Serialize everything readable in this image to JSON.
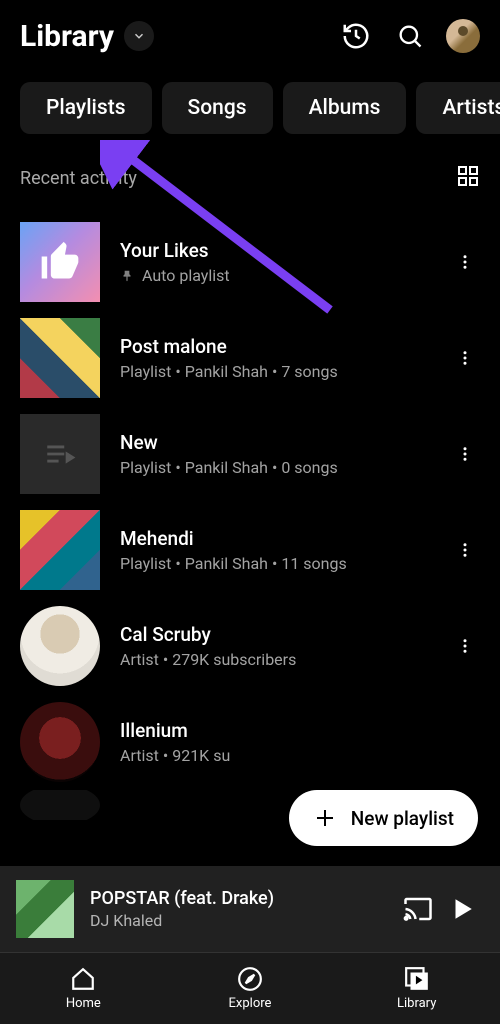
{
  "header": {
    "title": "Library"
  },
  "chips": {
    "playlists": "Playlists",
    "songs": "Songs",
    "albums": "Albums",
    "artists": "Artists"
  },
  "section": {
    "label": "Recent activity"
  },
  "items": [
    {
      "title": "Your Likes",
      "sub": "Auto playlist",
      "pinned": true,
      "artClass": "likes"
    },
    {
      "title": "Post malone",
      "sub": "Playlist • Pankil Shah • 7 songs",
      "artClass": "collage1"
    },
    {
      "title": "New",
      "sub": "Playlist • Pankil Shah • 0 songs",
      "artClass": "new"
    },
    {
      "title": "Mehendi",
      "sub": "Playlist • Pankil Shah • 11 songs",
      "artClass": "collage2"
    },
    {
      "title": "Cal Scruby",
      "sub": "Artist • 279K subscribers",
      "artClass": "cal round"
    },
    {
      "title": "Illenium",
      "sub": "Artist • 921K su",
      "artClass": "ill round"
    }
  ],
  "fab": {
    "label": "New playlist"
  },
  "miniplayer": {
    "title": "POPSTAR (feat. Drake)",
    "artist": "DJ Khaled"
  },
  "nav": {
    "home": "Home",
    "explore": "Explore",
    "library": "Library"
  },
  "colors": {
    "accent": "#7a3ff2"
  }
}
